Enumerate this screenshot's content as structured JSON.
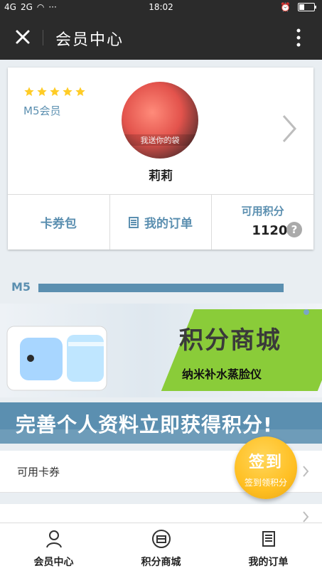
{
  "status_bar": {
    "signal_left": "4G",
    "signal_right": "2G",
    "more": "···",
    "time": "18:02"
  },
  "titlebar": {
    "title": "会员中心"
  },
  "member": {
    "level": "M5会员",
    "username": "莉莉",
    "avatar_caption": "我送你的袋",
    "stars_count": 5,
    "stars_color": "#ffcc26"
  },
  "quick_actions": {
    "coupons": "卡券包",
    "orders": "我的订单",
    "points_label": "可用积分",
    "points_value": "1120",
    "help": "?"
  },
  "progress": {
    "label": "M5"
  },
  "banner": {
    "title": "积分商城",
    "subtitle": "纳米补水蒸脸仪"
  },
  "promo": {
    "text": "完善个人资料立即获得积分!"
  },
  "list": {
    "item1": "可用卡券"
  },
  "signin": {
    "main": "签到",
    "sub": "签到领积分"
  },
  "bottom_nav": {
    "member": "会员中心",
    "mall": "积分商城",
    "orders": "我的订单"
  },
  "colors": {
    "accent": "#5b8fb0",
    "header": "#2b2b2b",
    "signin": "#ffbf22"
  },
  "icons": [
    "close-icon",
    "more-icon",
    "chevron-right-icon",
    "orders-list-icon",
    "help-icon",
    "member-icon",
    "mall-icon",
    "orders-icon"
  ]
}
